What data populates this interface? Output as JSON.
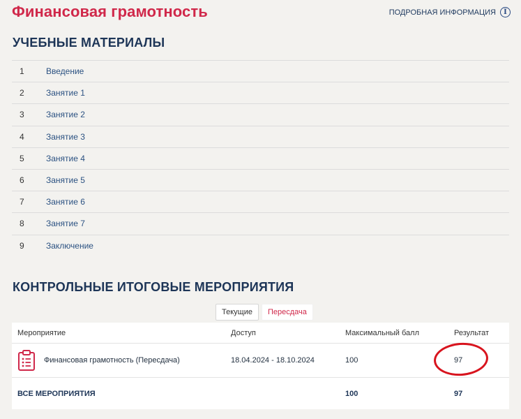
{
  "title": "Финансовая грамотность",
  "info_link": "ПОДРОБНАЯ ИНФОРМАЦИЯ",
  "materials": {
    "heading": "УЧЕБНЫЕ МАТЕРИАЛЫ",
    "items": [
      {
        "num": "1",
        "label": "Введение"
      },
      {
        "num": "2",
        "label": "Занятие 1"
      },
      {
        "num": "3",
        "label": "Занятие 2"
      },
      {
        "num": "4",
        "label": "Занятие 3"
      },
      {
        "num": "5",
        "label": "Занятие 4"
      },
      {
        "num": "6",
        "label": "Занятие 5"
      },
      {
        "num": "7",
        "label": "Занятие 6"
      },
      {
        "num": "8",
        "label": "Занятие 7"
      },
      {
        "num": "9",
        "label": "Заключение"
      }
    ]
  },
  "events": {
    "heading": "КОНТРОЛЬНЫЕ ИТОГОВЫЕ МЕРОПРИЯТИЯ",
    "tabs": {
      "current": "Текущие",
      "retake": "Пересдача"
    },
    "columns": {
      "event": "Мероприятие",
      "access": "Доступ",
      "max": "Максимальный балл",
      "result": "Результат"
    },
    "row": {
      "event": "Финансовая грамотность (Пересдача)",
      "access": "18.04.2024 - 18.10.2024",
      "max": "100",
      "result": "97"
    },
    "total": {
      "label": "ВСЕ МЕРОПРИЯТИЯ",
      "max": "100",
      "result": "97"
    }
  },
  "colors": {
    "accent": "#d0284a",
    "heading": "#1d3557",
    "link": "#2c5282",
    "annotation": "#d8141e"
  },
  "icons": {
    "info": "info-circle-icon",
    "event": "clipboard-list-icon"
  }
}
